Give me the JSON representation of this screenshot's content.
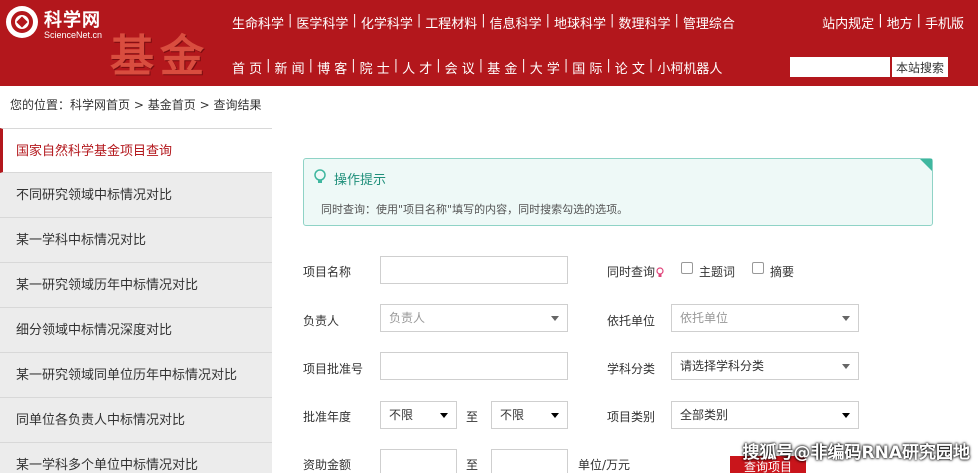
{
  "header": {
    "logo_cn": "科学网",
    "logo_en": "ScienceNet.cn",
    "section_title": "基金",
    "top_nav": [
      "生命科学",
      "医学科学",
      "化学科学",
      "工程材料",
      "信息科学",
      "地球科学",
      "数理科学",
      "管理综合"
    ],
    "right_nav": [
      "站内规定",
      "地方",
      "手机版"
    ],
    "bottom_nav": [
      "首 页",
      "新 闻",
      "博 客",
      "院 士",
      "人 才",
      "会 议",
      "基 金",
      "大 学",
      "国 际",
      "论 文",
      "小柯机器人"
    ],
    "site_search_button": "本站搜索"
  },
  "breadcrumb": {
    "prefix": "您的位置：",
    "items": [
      "科学网首页",
      "基金首页",
      "查询结果"
    ],
    "separator": ">"
  },
  "sidebar": {
    "items": [
      {
        "label": "国家自然科学基金项目查询",
        "active": true
      },
      {
        "label": "不同研究领域中标情况对比",
        "active": false
      },
      {
        "label": "某一学科中标情况对比",
        "active": false
      },
      {
        "label": "某一研究领域历年中标情况对比",
        "active": false
      },
      {
        "label": "细分领域中标情况深度对比",
        "active": false
      },
      {
        "label": "某一研究领域同单位历年中标情况对比",
        "active": false
      },
      {
        "label": "同单位各负责人中标情况对比",
        "active": false
      },
      {
        "label": "某一学科多个单位中标情况对比",
        "active": false
      }
    ]
  },
  "tip": {
    "title": "操作提示",
    "text": "同时查询：使用\"项目名称\"填写的内容，同时搜索勾选的选项。",
    "accent_color": "#3fb79f"
  },
  "form": {
    "project_name_label": "项目名称",
    "same_time_label": "同时查询",
    "keyword_label": "主题词",
    "abstract_label": "摘要",
    "leader_label": "负责人",
    "leader_placeholder": "负责人",
    "org_label": "依托单位",
    "org_placeholder": "依托单位",
    "approval_label": "项目批准号",
    "subject_label": "学科分类",
    "subject_placeholder": "请选择学科分类",
    "year_label": "批准年度",
    "year_from": "不限",
    "to_label": "至",
    "year_to": "不限",
    "category_label": "项目类别",
    "category_value": "全部类别",
    "amount_label": "资助金额",
    "amount_to_label": "至",
    "amount_unit": "单位/万元",
    "submit_label": "查询项目"
  },
  "watermark": "搜狐号@非编码RNA研究园地",
  "colors": {
    "brand": "#b3171c",
    "button": "#c9151b",
    "tip_border": "#8fd3c6"
  }
}
